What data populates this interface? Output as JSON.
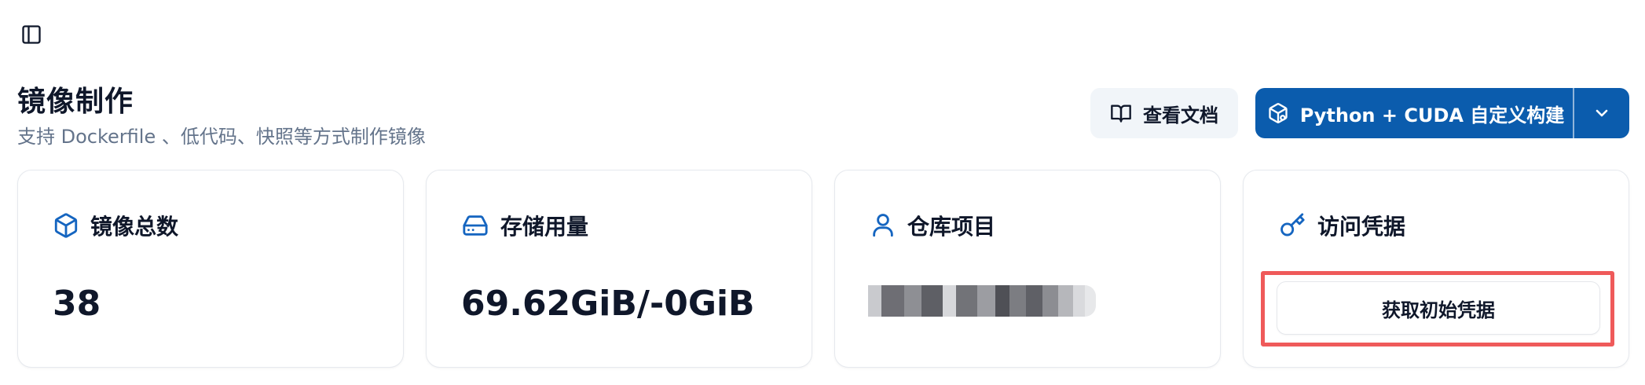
{
  "header": {
    "title": "镜像制作",
    "subtitle": "支持 Dockerfile 、低代码、快照等方式制作镜像",
    "docs_button_label": "查看文档",
    "build_button_label": "Python + CUDA 自定义构建"
  },
  "cards": {
    "images": {
      "label": "镜像总数",
      "value": "38",
      "icon": "box-icon"
    },
    "storage": {
      "label": "存储用量",
      "value": "69.62GiB/-0GiB",
      "icon": "hard-drive-icon"
    },
    "repo": {
      "label": "仓库项目",
      "icon": "user-icon"
    },
    "credentials": {
      "label": "访问凭据",
      "button_label": "获取初始凭据",
      "icon": "key-icon"
    }
  },
  "colors": {
    "accent": "#0b5cad",
    "icon_blue": "#1565c0",
    "highlight": "#ef5a5a"
  }
}
